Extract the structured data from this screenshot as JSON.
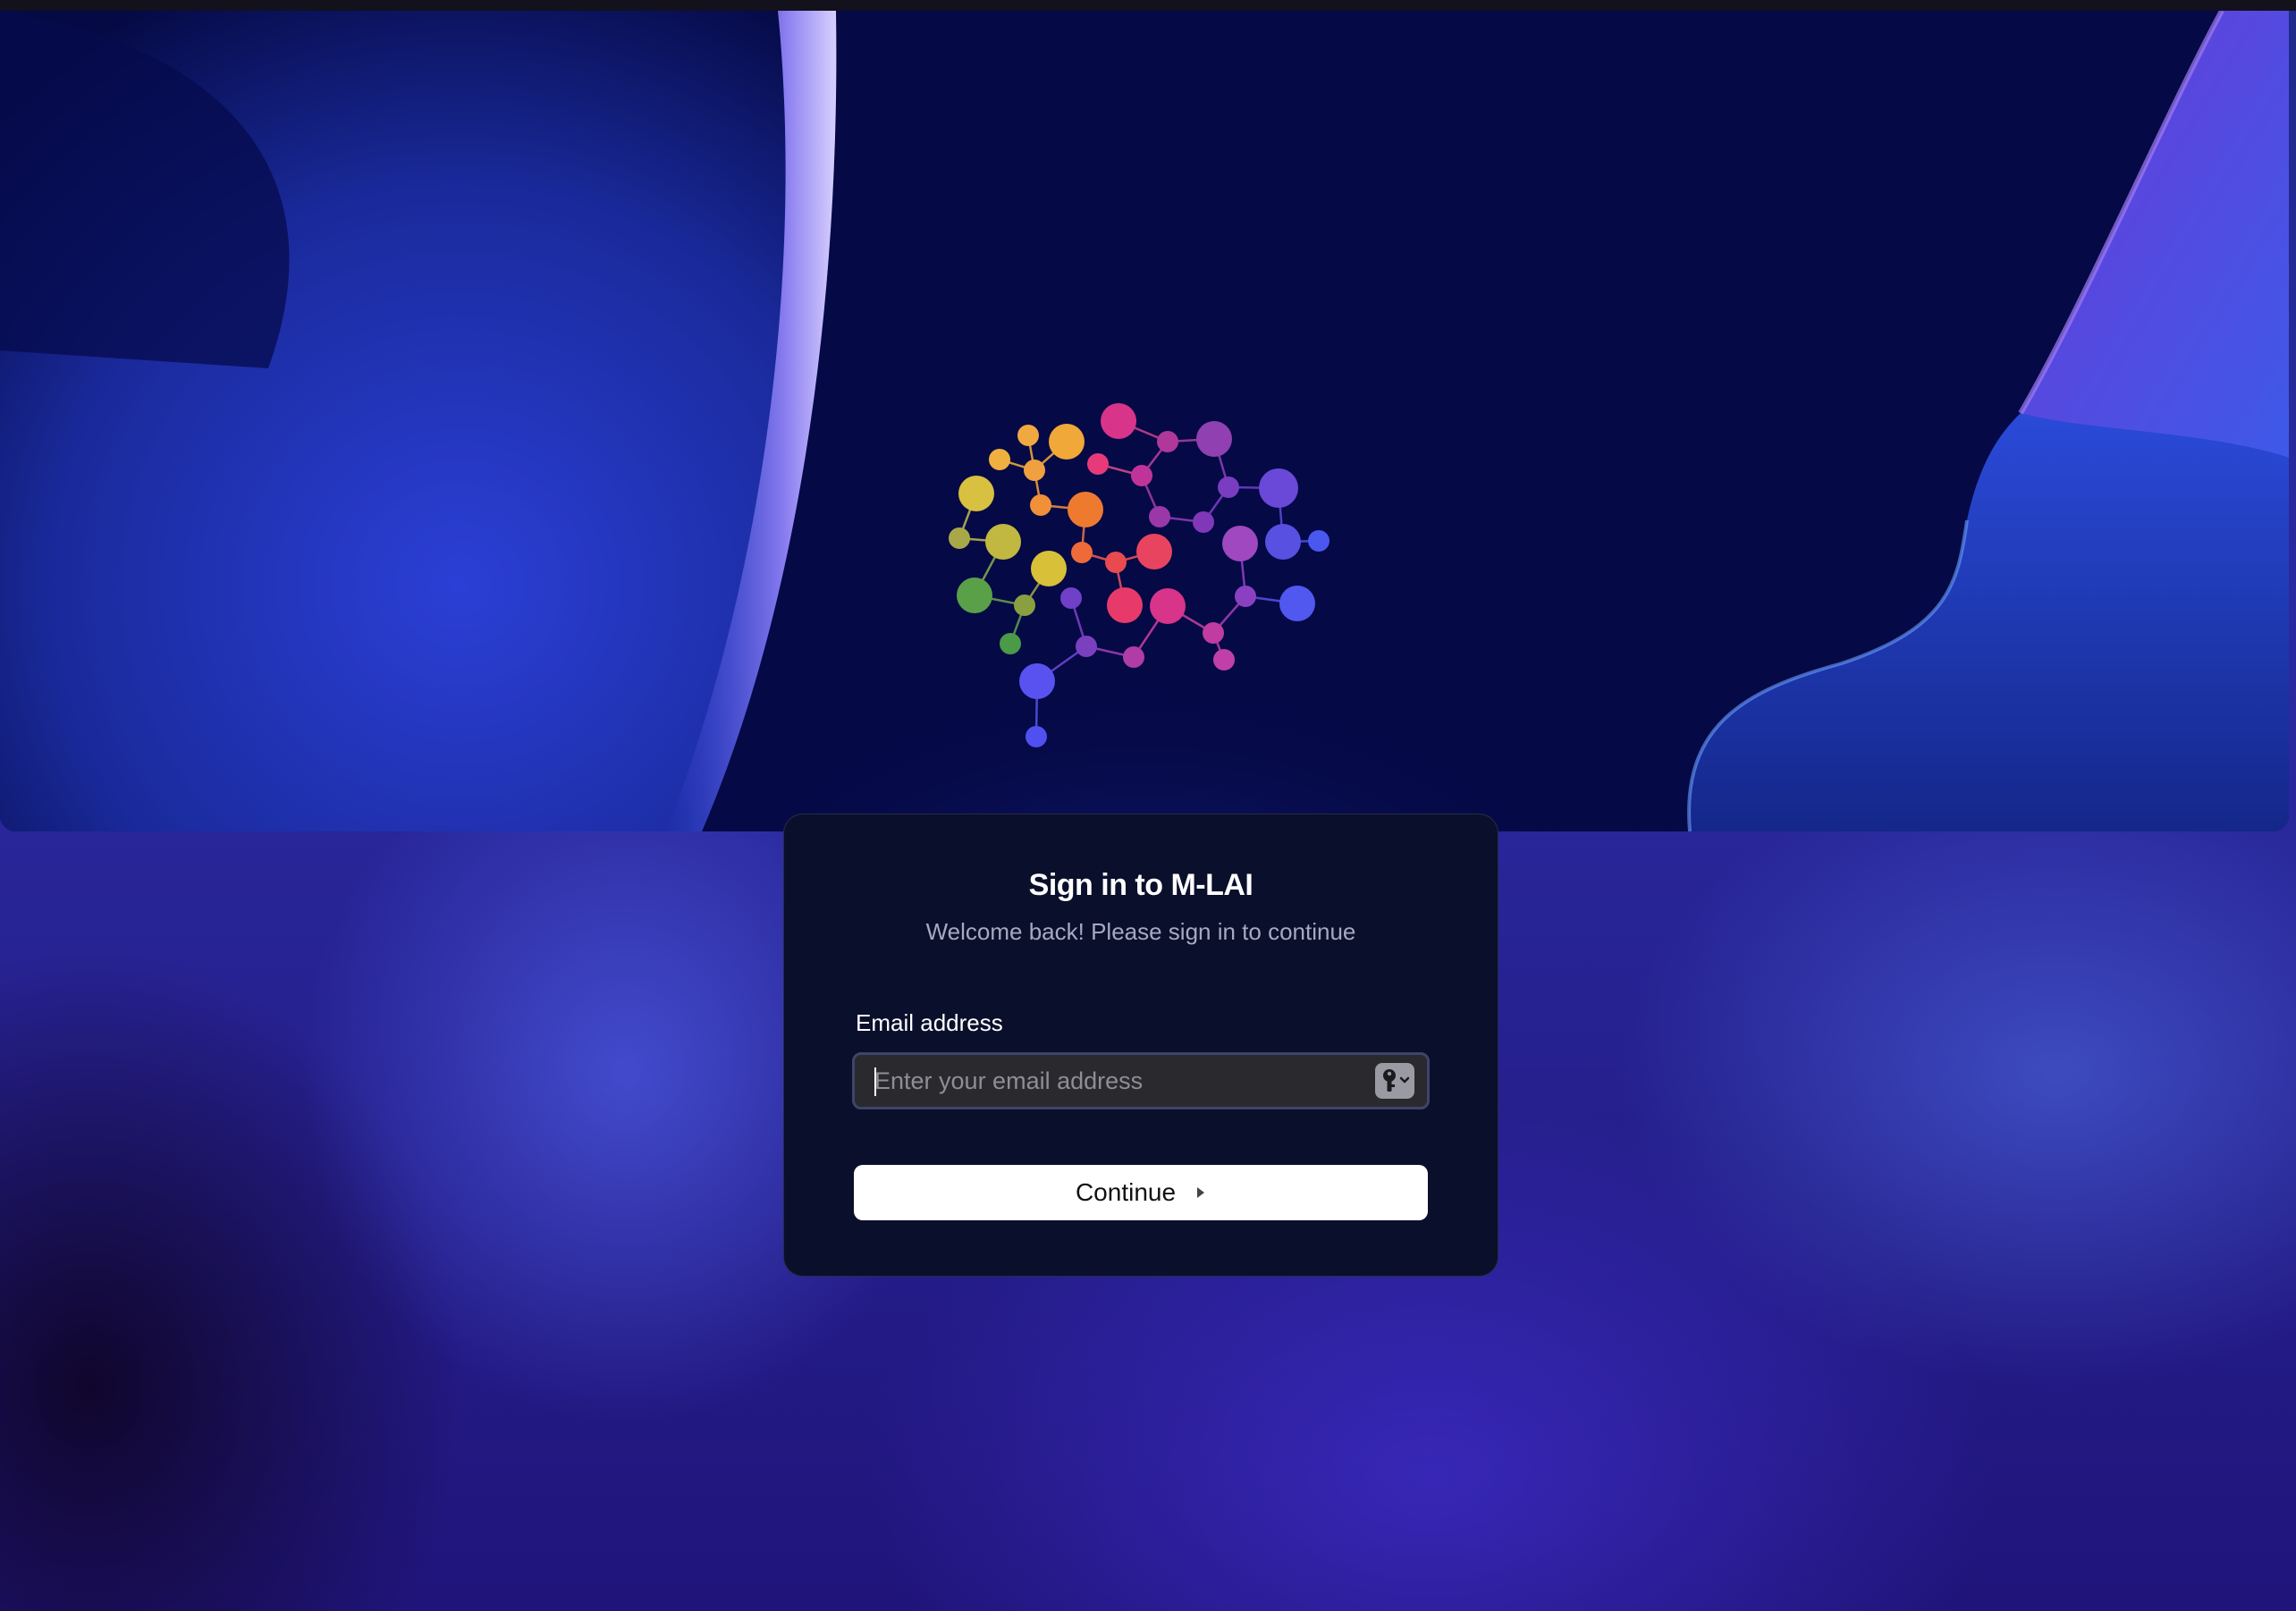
{
  "hero": {
    "logo": "molecule-network-logo",
    "colors": {
      "background": "#060a4a",
      "accent_purple": "#8f7cf0",
      "accent_blue": "#2a3fd0"
    }
  },
  "signin": {
    "title": "Sign in to M-LAI",
    "subtitle": "Welcome back! Please sign in to continue",
    "email_label": "Email address",
    "email_placeholder": "Enter your email address",
    "email_value": "",
    "password_manager_icon": "key-icon",
    "continue_label": "Continue",
    "continue_icon": "caret-right-icon"
  },
  "colors": {
    "card_background": "#0a0f2b",
    "button_background": "#ffffff",
    "input_border": "#3d4569"
  }
}
